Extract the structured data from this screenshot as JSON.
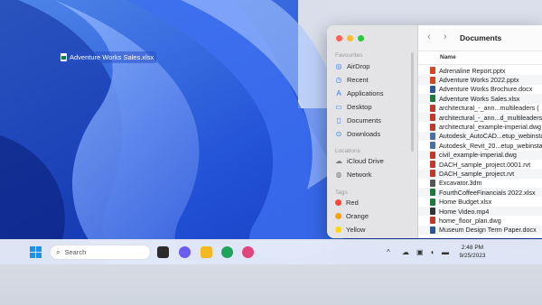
{
  "desktop": {
    "file_label": "Adventure Works Sales.xlsx"
  },
  "finder": {
    "title": "Documents",
    "back_icon": "chevron-left-icon",
    "forward_icon": "chevron-right-icon",
    "sections": {
      "favourites": "Favourites",
      "locations": "Locations",
      "tags": "Tags"
    },
    "favourites": [
      {
        "label": "AirDrop",
        "icon": "airdrop-icon"
      },
      {
        "label": "Recent",
        "icon": "clock-icon"
      },
      {
        "label": "Applications",
        "icon": "applications-icon"
      },
      {
        "label": "Desktop",
        "icon": "desktop-icon"
      },
      {
        "label": "Documents",
        "icon": "document-icon"
      },
      {
        "label": "Downloads",
        "icon": "download-icon"
      }
    ],
    "locations": [
      {
        "label": "iCloud Drive",
        "icon": "cloud-icon"
      },
      {
        "label": "Network",
        "icon": "globe-icon"
      }
    ],
    "tags": [
      {
        "label": "Red",
        "color": "#ff453a"
      },
      {
        "label": "Orange",
        "color": "#ff9f0a"
      },
      {
        "label": "Yellow",
        "color": "#ffd60a"
      }
    ],
    "column_header": "Name",
    "files": [
      {
        "name": "Adrenaline Report.pptx",
        "color": "#d24726"
      },
      {
        "name": "Adventure Works 2022.pptx",
        "color": "#d24726"
      },
      {
        "name": "Adventure Works Brochure.docx",
        "color": "#2b5797"
      },
      {
        "name": "Adventure Works Sales.xlsx",
        "color": "#1d7a3e"
      },
      {
        "name": "architectural_-_ann...multileaders (",
        "color": "#c0392b"
      },
      {
        "name": "architectural_-_ann...d_multileaders",
        "color": "#c0392b"
      },
      {
        "name": "architectural_example-imperial.dwg",
        "color": "#c0392b"
      },
      {
        "name": "Autodesk_AutoCAD...etup_webinsta",
        "color": "#4a6fa5"
      },
      {
        "name": "Autodesk_Revit_20...etup_webinsta",
        "color": "#4a6fa5"
      },
      {
        "name": "civil_example-imperial.dwg",
        "color": "#c0392b"
      },
      {
        "name": "DACH_sample_project.0001.rvt",
        "color": "#c0392b"
      },
      {
        "name": "DACH_sample_project.rvt",
        "color": "#c0392b"
      },
      {
        "name": "Excavator.3dm",
        "color": "#555555"
      },
      {
        "name": "FourthCoffeeFinancials 2022.xlsx",
        "color": "#1d7a3e"
      },
      {
        "name": "Home Budget.xlsx",
        "color": "#1d7a3e"
      },
      {
        "name": "Home Video.mp4",
        "color": "#333333"
      },
      {
        "name": "home_floor_plan.dwg",
        "color": "#c0392b"
      },
      {
        "name": "Museum Design Term Paper.docx",
        "color": "#2b5797"
      }
    ]
  },
  "taskbar": {
    "search_placeholder": "Search",
    "time": "2:48 PM",
    "date": "9/25/2023",
    "apps": [
      "file-explorer-icon",
      "chat-icon",
      "folder-icon",
      "edge-icon",
      "store-icon"
    ],
    "tray": [
      "chevron-up-icon",
      "onedrive-icon",
      "network-icon",
      "volume-icon",
      "battery-icon"
    ]
  }
}
